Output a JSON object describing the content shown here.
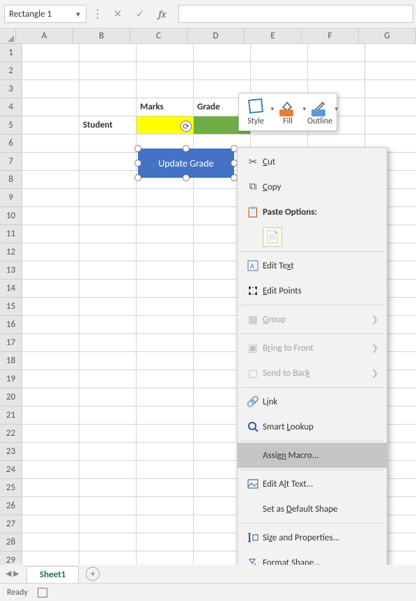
{
  "name_box": "Rectangle 1",
  "formula_value": "",
  "columns": [
    "A",
    "B",
    "C",
    "D",
    "E",
    "F",
    "G"
  ],
  "row_count": 29,
  "cells": {
    "r4c3": "Marks",
    "r4c4": "Grade",
    "r5c2": "Student"
  },
  "shape": {
    "label": "Update Grade"
  },
  "mini_toolbar": {
    "style": "Style",
    "fill": "Fill",
    "outline": "Outline"
  },
  "context_menu": {
    "cut": "Cut",
    "copy": "Copy",
    "paste_header": "Paste Options:",
    "edit_text": "Edit Text",
    "edit_points": "Edit Points",
    "group": "Group",
    "bring_front": "Bring to Front",
    "send_back": "Send to Back",
    "link": "Link",
    "smart_lookup": "Smart Lookup",
    "assign_macro": "Assign Macro...",
    "alt_text": "Edit Alt Text...",
    "default_shape": "Set as Default Shape",
    "size_props": "Size and Properties...",
    "format_shape": "Format Shape..."
  },
  "sheet_tab": "Sheet1",
  "status": "Ready"
}
